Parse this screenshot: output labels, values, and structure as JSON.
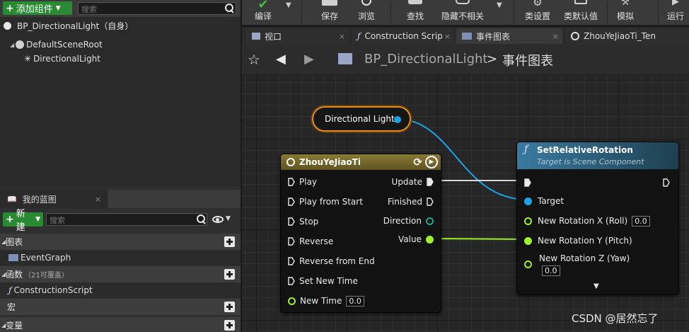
{
  "components_panel": {
    "add_button_label": "添加组件",
    "search_placeholder": "搜索",
    "root_item": "BP_DirectionalLight（自身）",
    "tree_items": [
      "DefaultSceneRoot",
      "DirectionalLight"
    ]
  },
  "my_blueprint": {
    "tab_label": "我的蓝图",
    "new_button_label": "新建",
    "search_placeholder": "搜索",
    "sections": [
      {
        "label": "图表",
        "items": [
          "EventGraph"
        ]
      },
      {
        "label": "函数",
        "note": "（21可覆盖）",
        "items": [
          "ConstructionScript"
        ]
      },
      {
        "label": "宏",
        "items": []
      },
      {
        "label": "变量",
        "items": []
      }
    ]
  },
  "toolbar": {
    "buttons": [
      {
        "id": "compile",
        "label": "编译",
        "icon": "compile-check-icon"
      },
      {
        "id": "save",
        "label": "保存",
        "icon": "save-icon"
      },
      {
        "id": "browse",
        "label": "浏览",
        "icon": "magnifier-icon"
      },
      {
        "id": "find",
        "label": "查找",
        "icon": "binoculars-icon"
      },
      {
        "id": "hide_unrelated",
        "label": "隐藏不相关",
        "icon": "hide-unrelated-icon"
      },
      {
        "id": "class_settings",
        "label": "类设置",
        "icon": "gear-icon"
      },
      {
        "id": "class_defaults",
        "label": "类默认值",
        "icon": "defaults-icon"
      },
      {
        "id": "simulate",
        "label": "模拟",
        "icon": "simulate-icon"
      },
      {
        "id": "run",
        "label": "运行",
        "icon": "play-icon"
      }
    ]
  },
  "editor_tabs": [
    {
      "label": "视口",
      "icon": "viewport-icon"
    },
    {
      "label": "Construction Scrip",
      "icon": "function-icon"
    },
    {
      "label": "事件图表",
      "icon": "graph-icon",
      "active": true
    },
    {
      "label": "ZhouYeJiaoTi_Ten",
      "icon": "clock-icon"
    }
  ],
  "graph_nav": {
    "blueprint_name": "BP_DirectionalLight",
    "separator": ">",
    "graph_name": "事件图表"
  },
  "nodes": {
    "variable": {
      "label": "Directional Light"
    },
    "timeline": {
      "title": "ZhouYeJiaoTi",
      "inputs": [
        "Play",
        "Play from Start",
        "Stop",
        "Reverse",
        "Reverse from End",
        "Set New Time"
      ],
      "new_time_label": "New Time",
      "new_time_value": "0.0",
      "outputs": [
        "Update",
        "Finished",
        "Direction",
        "Value"
      ]
    },
    "set_rotation": {
      "title": "SetRelativeRotation",
      "subtitle": "Target is Scene Component",
      "target_label": "Target",
      "x_label": "New Rotation X (Roll)",
      "x_value": "0.0",
      "y_label": "New Rotation Y (Pitch)",
      "z_label": "New Rotation Z (Yaw)",
      "z_value": "0.0"
    }
  },
  "colors": {
    "timeline_header": "#7a6a2a",
    "function_header": "#2f6f8f",
    "object_pin": "#1aa3e8",
    "float_pin": "#9df02c",
    "variable_outline": "#e18d1f",
    "add_button": "#2a8a34"
  },
  "watermark": "CSDN @居然忘了"
}
